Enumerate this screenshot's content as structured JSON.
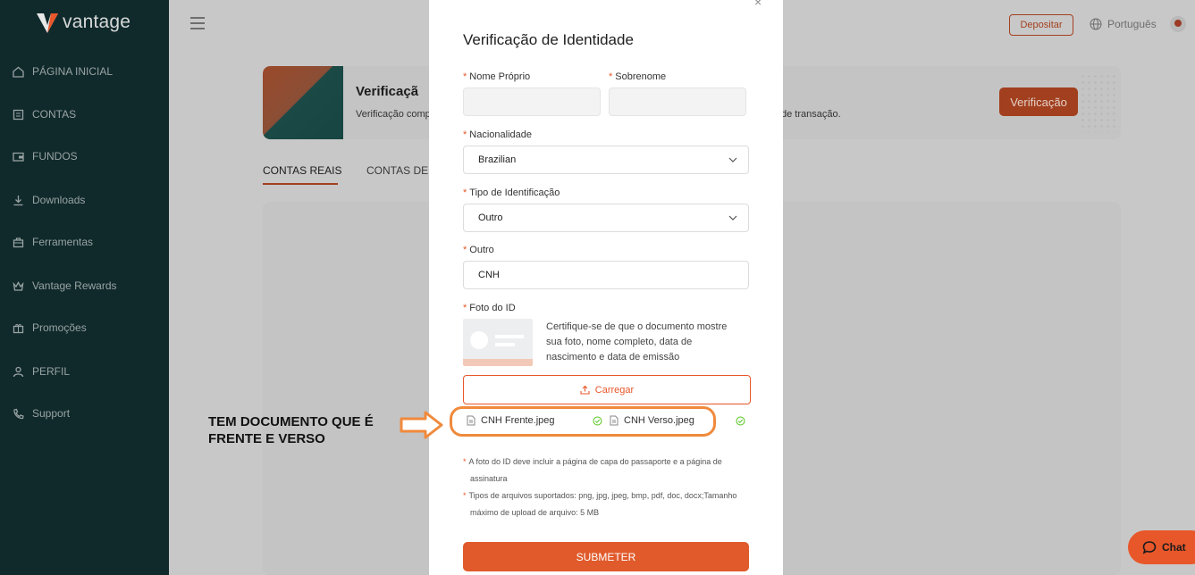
{
  "brand": {
    "name": "vantage"
  },
  "sidebar": {
    "items": [
      {
        "label": "PÁGINA INICIAL",
        "icon": "home-icon"
      },
      {
        "label": "CONTAS",
        "icon": "accounts-icon"
      },
      {
        "label": "FUNDOS",
        "icon": "funds-icon"
      },
      {
        "label": "Downloads",
        "icon": "download-icon"
      },
      {
        "label": "Ferramentas",
        "icon": "tools-icon"
      },
      {
        "label": "Vantage Rewards",
        "icon": "crown-icon"
      },
      {
        "label": "Promoções",
        "icon": "gift-icon"
      },
      {
        "label": "PERFIL",
        "icon": "profile-icon"
      },
      {
        "label": "Support",
        "icon": "support-icon"
      }
    ]
  },
  "header": {
    "deposit_label": "Depositar",
    "language": "Português"
  },
  "banner": {
    "title": "Verificaçã",
    "subtitle_left": "Verificação comp",
    "subtitle_right": "de transação.",
    "button": "Verificação"
  },
  "tabs": [
    {
      "label": "CONTAS REAIS"
    },
    {
      "label": "CONTAS DE D"
    }
  ],
  "modal": {
    "title": "Verificação de Identidade",
    "fields": {
      "first_name": {
        "label": "Nome Próprio"
      },
      "last_name": {
        "label": "Sobrenome"
      },
      "nationality": {
        "label": "Nacionalidade",
        "value": "Brazilian"
      },
      "id_type": {
        "label": "Tipo de Identificação",
        "value": "Outro"
      },
      "other": {
        "label": "Outro",
        "value": "CNH"
      },
      "photo": {
        "label": "Foto do ID"
      }
    },
    "photo_description": "Certifique-se de que o documento mostre sua foto, nome completo, data de nascimento e data de emissão",
    "upload_label": "Carregar",
    "files": [
      {
        "name": "CNH Frente.jpeg",
        "status": "uploaded"
      },
      {
        "name": "CNH Verso.jpeg",
        "status": "uploaded"
      }
    ],
    "notes": [
      "A foto do ID deve incluir a página de capa do passaporte e a página de assinatura",
      "Tipos de arquivos suportados: png, jpg, jpeg, bmp, pdf, doc, docx;Tamanho máximo de upload de arquivo: 5 MB"
    ],
    "submit_label": "SUBMETER"
  },
  "annotation": {
    "text_line1": "TEM DOCUMENTO QUE É",
    "text_line2": "FRENTE E VERSO"
  },
  "chat": {
    "label": "Chat"
  },
  "colors": {
    "sidebar": "#102a2c",
    "accent": "#e8572a",
    "highlight": "#f08a3c"
  }
}
